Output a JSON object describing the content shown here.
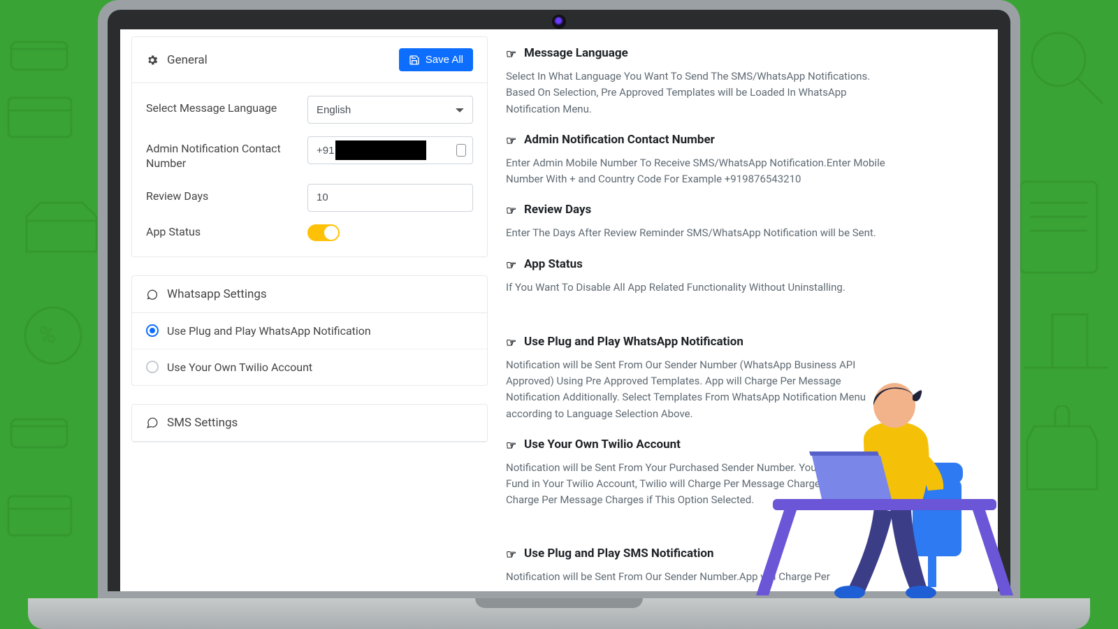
{
  "general": {
    "title": "General",
    "save_label": "Save All",
    "fields": {
      "language_label": "Select Message Language",
      "language_value": "English",
      "admin_contact_label": "Admin Notification Contact Number",
      "admin_contact_value": "+91",
      "review_days_label": "Review Days",
      "review_days_value": "10",
      "app_status_label": "App Status",
      "app_status_on": true
    }
  },
  "whatsapp": {
    "title": "Whatsapp Settings",
    "options": [
      {
        "label": "Use Plug and Play WhatsApp Notification",
        "checked": true
      },
      {
        "label": "Use Your Own Twilio Account",
        "checked": false
      }
    ]
  },
  "sms": {
    "title": "SMS Settings"
  },
  "help": {
    "message_language": {
      "title": "Message Language",
      "body": "Select In What Language You Want To Send The SMS/WhatsApp Notifications. Based On Selection, Pre Approved Templates will be Loaded In WhatsApp Notification Menu."
    },
    "admin_contact": {
      "title": "Admin Notification Contact Number",
      "body": "Enter Admin Mobile Number To Receive SMS/WhatsApp Notification.Enter Mobile Number With + and Country Code For Example +919876543210"
    },
    "review_days": {
      "title": "Review Days",
      "body": "Enter The Days After Review Reminder SMS/WhatsApp Notification will be Sent."
    },
    "app_status": {
      "title": "App Status",
      "body": "If You Want To Disable All App Related Functionality Without Uninstalling."
    },
    "pp_whatsapp": {
      "title": "Use Plug and Play WhatsApp Notification",
      "body": "Notification will be Sent From Our Sender Number (WhatsApp Business API Approved) Using Pre Approved Templates. App will Charge Per Message Notification Additionally. Select Templates From WhatsApp Notification Menu according to Language Selection Above."
    },
    "own_twilio": {
      "title": "Use Your Own Twilio Account",
      "body": "Notification will be Sent From Your Purchased Sender Number. You Need to Add Fund in Your Twilio Account, Twilio will Charge Per Message Charges. App will Not Charge Per Message Charges if This Option Selected."
    },
    "pp_sms": {
      "title": "Use Plug and Play SMS Notification",
      "body": "Notification will be Sent From Our Sender Number.App will Charge Per"
    }
  }
}
